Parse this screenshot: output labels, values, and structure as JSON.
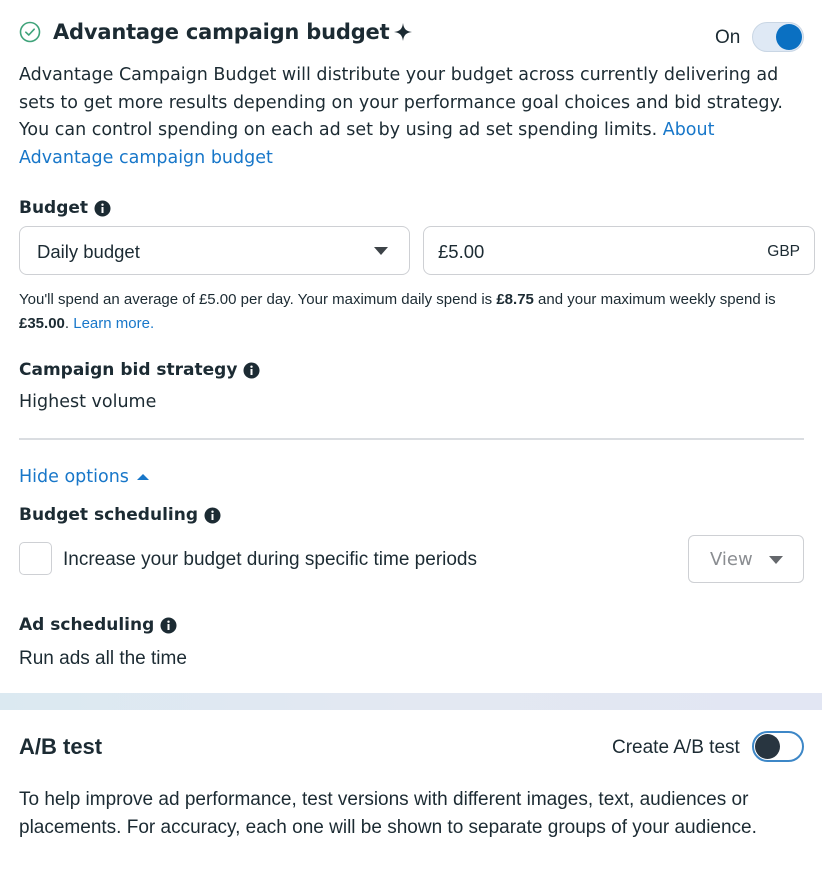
{
  "advantage": {
    "title": "Advantage campaign budget",
    "toggle_label": "On",
    "toggle_state": "on",
    "description": "Advantage Campaign Budget will distribute your budget across currently delivering ad sets to get more results depending on your performance goal choices and bid strategy. You can control spending on each ad set by using ad set spending limits. ",
    "description_link": "About Advantage campaign budget",
    "icons": {
      "status": "check-circle-icon",
      "badge": "sparkle-icon"
    }
  },
  "budget": {
    "label": "Budget",
    "type_selected": "Daily budget",
    "amount_value": "£5.00",
    "currency": "GBP",
    "note_part1": "You'll spend an average of £5.00 per day. Your maximum daily spend is ",
    "note_max_daily": "£8.75",
    "note_part2": " and your maximum weekly spend is ",
    "note_max_weekly": "£35.00",
    "note_part3": ". ",
    "note_link": "Learn more."
  },
  "bid_strategy": {
    "label": "Campaign bid strategy",
    "value": "Highest volume"
  },
  "options_toggle": "Hide options",
  "budget_scheduling": {
    "label": "Budget scheduling",
    "checkbox_label": "Increase your budget during specific time periods",
    "checked": false,
    "view_button": "View"
  },
  "ad_scheduling": {
    "label": "Ad scheduling",
    "value": "Run ads all the time"
  },
  "ab_test": {
    "title": "A/B test",
    "toggle_label": "Create A/B test",
    "toggle_state": "off",
    "description": "To help improve ad performance, test versions with different images, text, audiences or placements. For accuracy, each one will be shown to separate groups of your audience."
  },
  "colors": {
    "accent": "#0a70c2",
    "link": "#1877c9",
    "text": "#1c2b33",
    "check_green": "#3fa37a"
  }
}
